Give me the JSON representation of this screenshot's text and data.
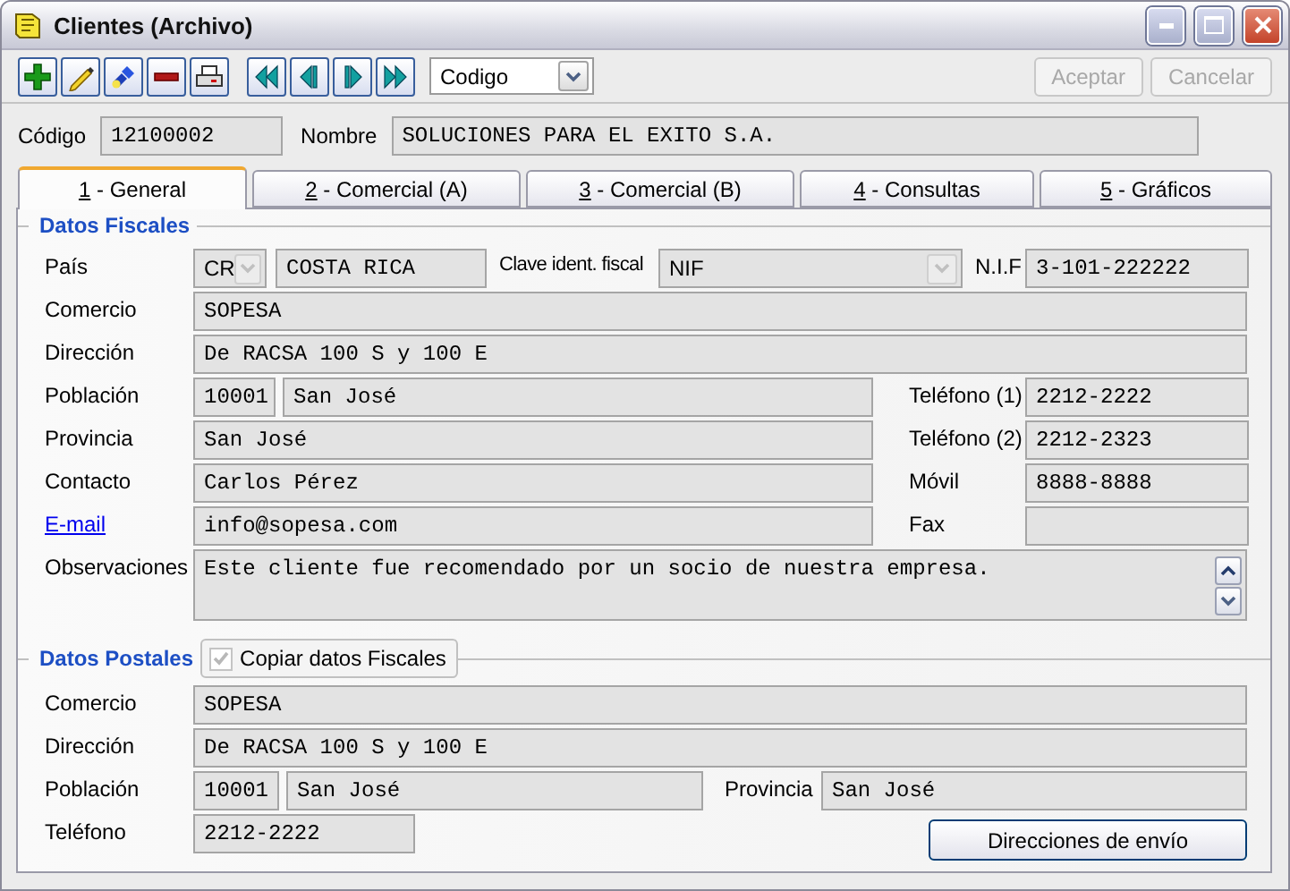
{
  "window": {
    "title": "Clientes (Archivo)"
  },
  "toolbar": {
    "sort_select": {
      "value": "Codigo"
    },
    "actions": [
      {
        "label": "Aceptar",
        "disabled": true
      },
      {
        "label": "Cancelar",
        "disabled": true
      }
    ]
  },
  "header": {
    "codigo": {
      "label": "Código",
      "value": "12100002"
    },
    "nombre": {
      "label": "Nombre",
      "value": "SOLUCIONES PARA EL EXITO S.A."
    }
  },
  "tabs": [
    {
      "label": "1 - General",
      "selected": true
    },
    {
      "label": "2 - Comercial (A)",
      "selected": false
    },
    {
      "label": "3 - Comercial (B)",
      "selected": false
    },
    {
      "label": "4 - Consultas",
      "selected": false
    },
    {
      "label": "5 - Gráficos",
      "selected": false
    }
  ],
  "fiscal": {
    "title": "Datos Fiscales",
    "pais": {
      "label": "País",
      "code": "CR",
      "name": "COSTA RICA"
    },
    "clave": {
      "label": "Clave ident. fiscal",
      "value": "NIF"
    },
    "nif": {
      "label": "N.I.F",
      "value": "3-101-222222"
    },
    "comercio": {
      "label": "Comercio",
      "value": "SOPESA"
    },
    "direccion": {
      "label": "Dirección",
      "value": "De RACSA 100 S y 100 E"
    },
    "poblacion": {
      "label": "Población",
      "code": "10001",
      "name": "San José"
    },
    "telefono1": {
      "label": "Teléfono (1)",
      "value": "2212-2222"
    },
    "provincia": {
      "label": "Provincia",
      "value": "San José"
    },
    "telefono2": {
      "label": "Teléfono (2)",
      "value": "2212-2323"
    },
    "contacto": {
      "label": "Contacto",
      "value": "Carlos Pérez"
    },
    "movil": {
      "label": "Móvil",
      "value": "8888-8888"
    },
    "email": {
      "label": "E-mail",
      "value": "info@sopesa.com"
    },
    "fax": {
      "label": "Fax"
    },
    "observaciones": {
      "label": "Observaciones",
      "value": "Este cliente fue recomendado por un socio de nuestra empresa."
    }
  },
  "postal": {
    "title": "Datos Postales",
    "copy": {
      "label": "Copiar datos Fiscales",
      "checked": true,
      "disabled": true
    },
    "comercio": {
      "label": "Comercio",
      "value": "SOPESA"
    },
    "direccion": {
      "label": "Dirección",
      "value": "De RACSA 100 S y 100 E"
    },
    "poblacion": {
      "label": "Población",
      "code": "10001",
      "name": "San José"
    },
    "provincia": {
      "label": "Provincia",
      "value": "San José"
    },
    "telefono": {
      "label": "Teléfono",
      "value": "2212-2222"
    },
    "button": {
      "label": "Direcciones de envío"
    }
  }
}
